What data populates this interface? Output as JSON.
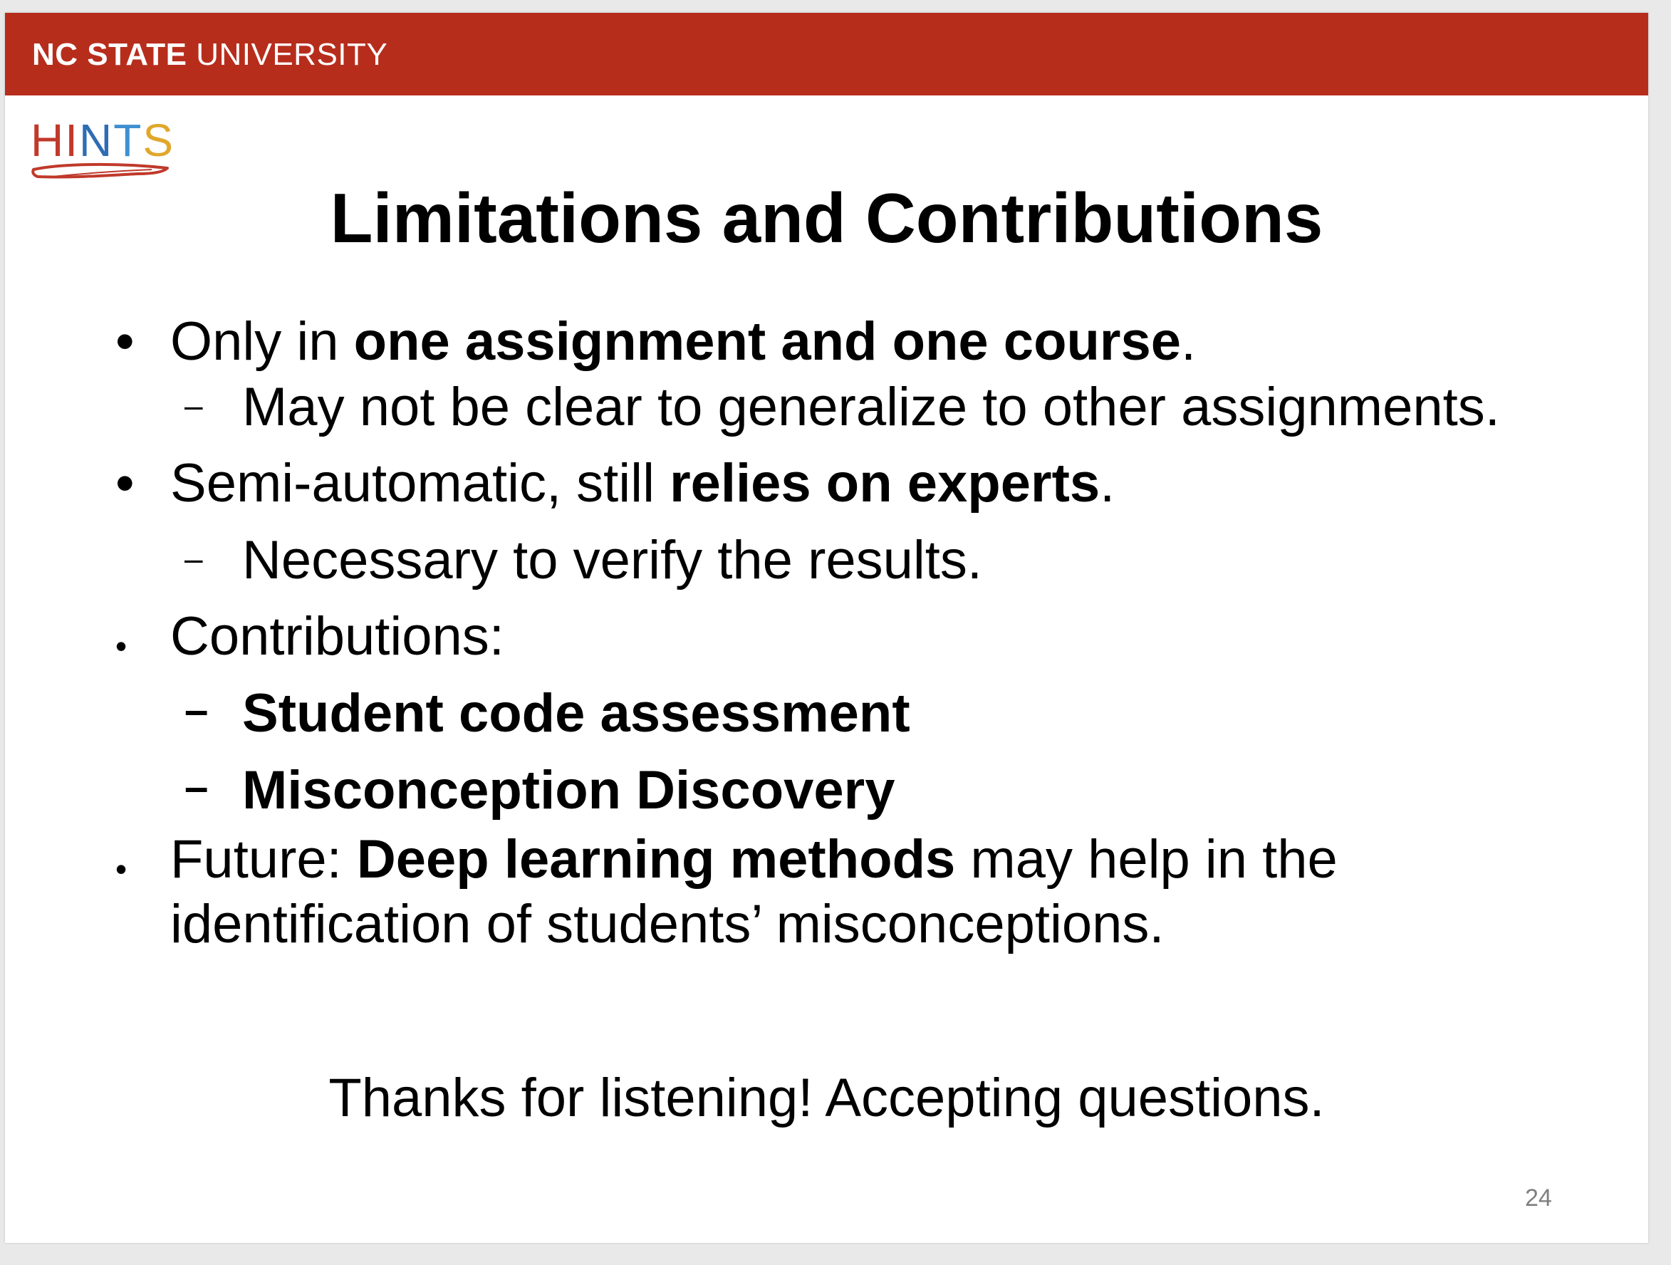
{
  "header": {
    "brand_bold": "NC STATE",
    "brand_regular": "UNIVERSITY",
    "bar_color": "#b72d1c"
  },
  "logo": {
    "text": "HINTS",
    "letter_colors": [
      "#c0392b",
      "#c0392b",
      "#2e6db4",
      "#3f8fd0",
      "#e0a72b"
    ],
    "icon": "hand-icon"
  },
  "slide": {
    "title": "Limitations and Contributions",
    "bullets": [
      {
        "parts": [
          {
            "text": "Only in ",
            "bold": false
          },
          {
            "text": "one assignment and one course",
            "bold": true
          },
          {
            "text": ".",
            "bold": false
          }
        ],
        "sub": [
          {
            "parts": [
              {
                "text": "May not be clear to generalize to other assignments.",
                "bold": false
              }
            ]
          }
        ]
      },
      {
        "parts": [
          {
            "text": "Semi-automatic, still ",
            "bold": false
          },
          {
            "text": "relies on experts",
            "bold": true
          },
          {
            "text": ".",
            "bold": false
          }
        ],
        "sub": [
          {
            "parts": [
              {
                "text": "Necessary to verify the results.",
                "bold": false
              }
            ]
          }
        ]
      },
      {
        "parts": [
          {
            "text": "Contributions:",
            "bold": false
          }
        ],
        "sub": [
          {
            "parts": [
              {
                "text": "Student code assessment",
                "bold": true
              }
            ]
          },
          {
            "parts": [
              {
                "text": "Misconception Discovery",
                "bold": true
              }
            ]
          }
        ]
      },
      {
        "parts": [
          {
            "text": "Future: ",
            "bold": false
          },
          {
            "text": "Deep learning methods",
            "bold": true
          },
          {
            "text": " may help in the",
            "bold": false
          }
        ],
        "continuation": "identification of students’ misconceptions.",
        "sub": []
      }
    ],
    "bullet_marker": "•",
    "sub_marker": "–",
    "closing": "Thanks for listening! Accepting questions.",
    "page_number": "24"
  }
}
